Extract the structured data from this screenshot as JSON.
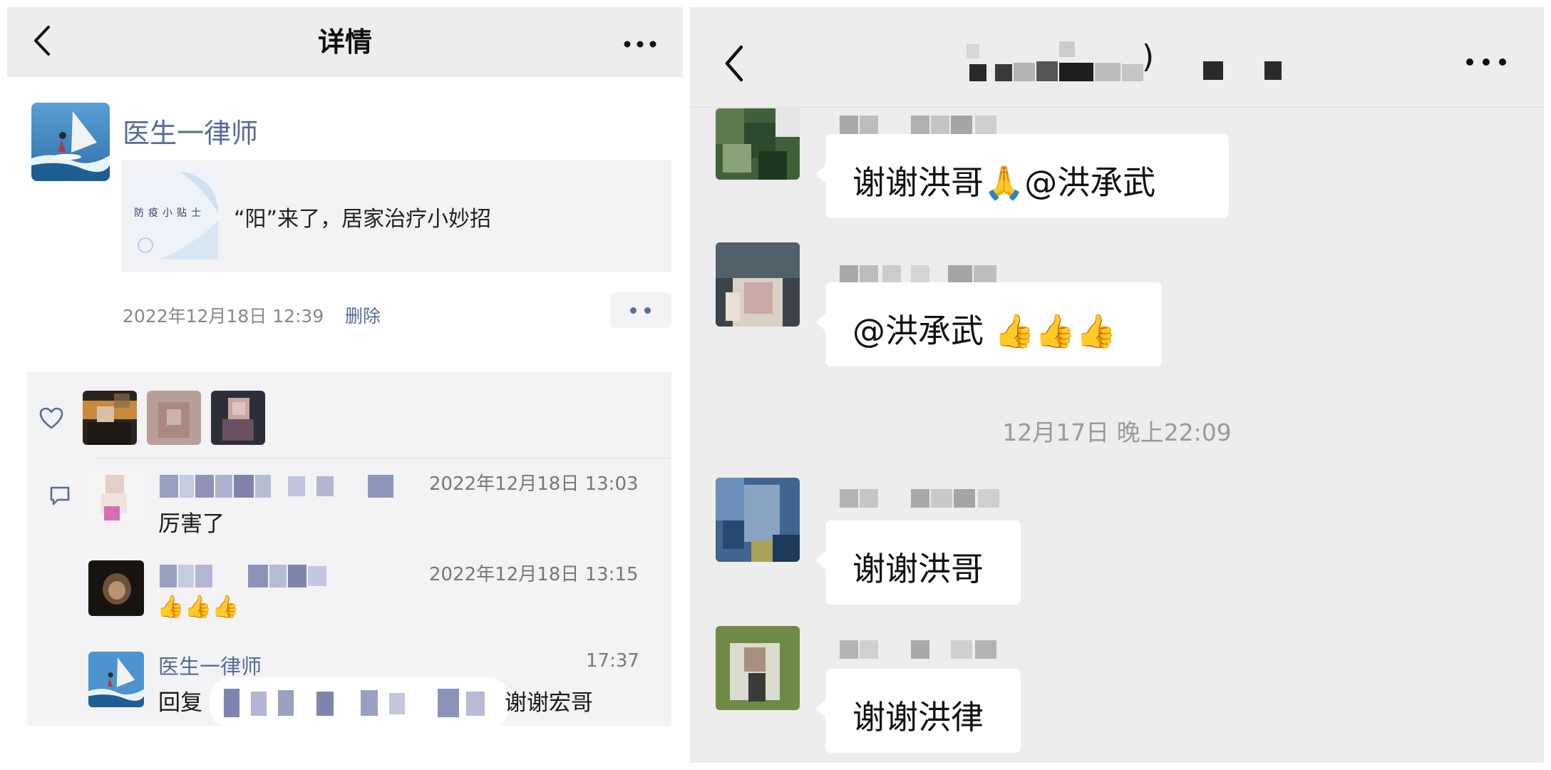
{
  "moments": {
    "header": {
      "title": "详情"
    },
    "post": {
      "author": "医生一律师",
      "share_title": "“阳”来了，居家治疗小妙招",
      "share_thumb_text": "防疫小贴士",
      "time": "2022年12月18日 12:39",
      "delete_label": "删除"
    },
    "comments": [
      {
        "time": "2022年12月18日 13:03",
        "text": "厉害了"
      },
      {
        "time": "2022年12月18日 13:15",
        "text": "👍👍👍"
      },
      {
        "name": "医生一律师",
        "time": "17:37",
        "text_prefix": "回复",
        "text_suffix": "谢谢宏哥"
      }
    ]
  },
  "chat": {
    "header": {
      "title_suffix": ")"
    },
    "messages": [
      {
        "text": "谢谢洪哥🙏@洪承武"
      },
      {
        "text": "@洪承武 👍👍👍"
      }
    ],
    "timestamp": "12月17日 晚上22:09",
    "messages_after": [
      {
        "text": "谢谢洪哥"
      },
      {
        "text": "谢谢洪律"
      }
    ]
  },
  "icons": [
    "back-icon",
    "more-icon",
    "heart-icon",
    "comment-icon"
  ],
  "colors": {
    "link": "#576b95",
    "header_bg": "#ededed",
    "chat_bg": "#ededed",
    "bubble_bg": "#ffffff"
  }
}
